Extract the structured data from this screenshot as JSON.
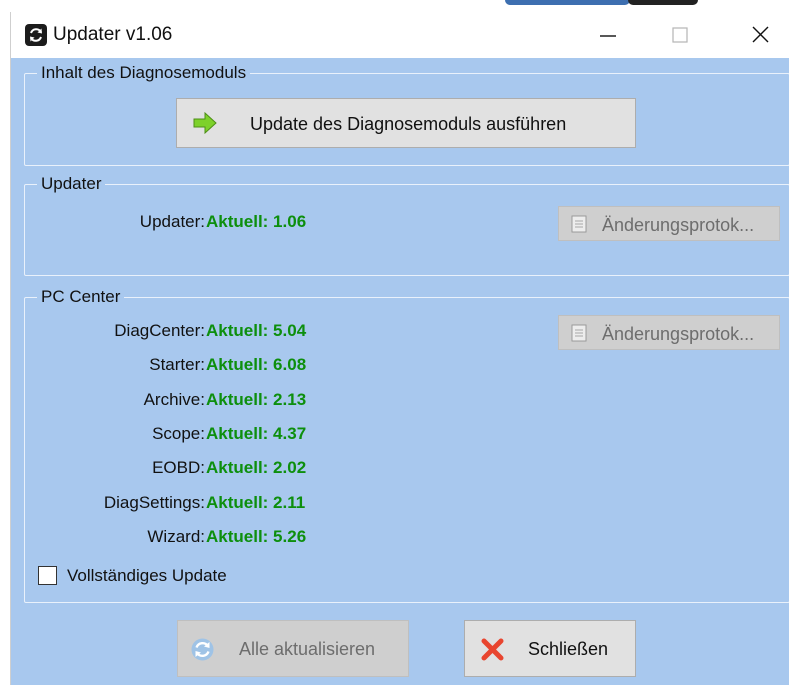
{
  "window": {
    "title": "Updater v1.06",
    "icon": "refresh-icon"
  },
  "module_group": {
    "legend": "Inhalt des Diagnosemoduls",
    "update_button": {
      "label": "Update des Diagnosemoduls ausführen",
      "icon": "arrow-right-icon"
    }
  },
  "updater_group": {
    "legend": "Updater",
    "row": {
      "label": "Updater:",
      "value": "Aktuell: 1.06"
    },
    "changelog_button": {
      "label": "Änderungsprotok...",
      "icon": "document-icon"
    }
  },
  "pc_center_group": {
    "legend": "PC Center",
    "rows": [
      {
        "label": "DiagCenter:",
        "value": "Aktuell: 5.04"
      },
      {
        "label": "Starter:",
        "value": "Aktuell: 6.08"
      },
      {
        "label": "Archive:",
        "value": "Aktuell: 2.13"
      },
      {
        "label": "Scope:",
        "value": "Aktuell: 4.37"
      },
      {
        "label": "EOBD:",
        "value": "Aktuell: 2.02"
      },
      {
        "label": "DiagSettings:",
        "value": "Aktuell: 2.11"
      },
      {
        "label": "Wizard:",
        "value": "Aktuell: 5.26"
      }
    ],
    "changelog_button": {
      "label": "Änderungsprotok...",
      "icon": "document-icon"
    },
    "full_update_checkbox": {
      "label": "Vollständiges Update",
      "checked": false
    }
  },
  "footer": {
    "update_all_button": {
      "label": "Alle aktualisieren",
      "icon": "refresh-icon",
      "enabled": false
    },
    "close_button": {
      "label": "Schließen",
      "icon": "close-x-icon"
    }
  },
  "colors": {
    "client_background": "#a8c8ee",
    "status_green": "#0d8f0d"
  }
}
